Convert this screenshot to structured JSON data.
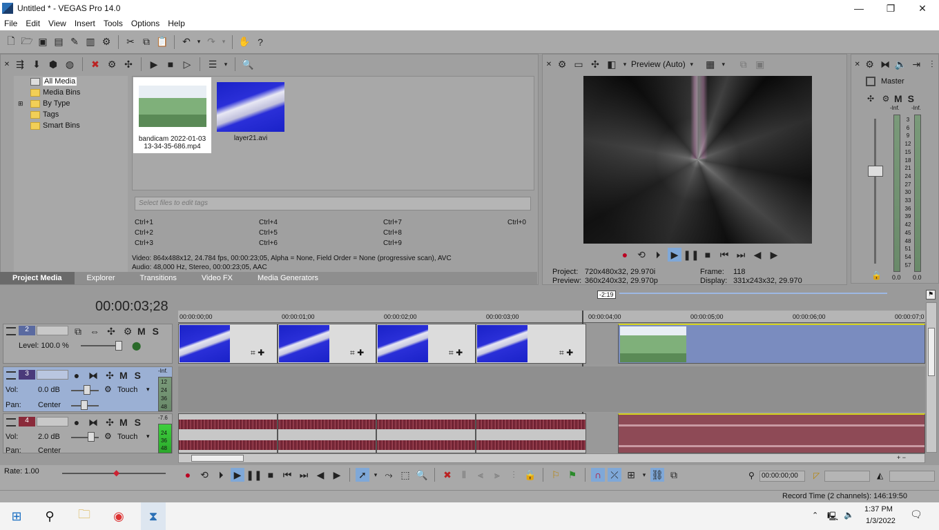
{
  "window": {
    "title": "Untitled * - VEGAS Pro 14.0",
    "controls": [
      "—",
      "❐",
      "✕"
    ]
  },
  "menu": [
    "File",
    "Edit",
    "View",
    "Insert",
    "Tools",
    "Options",
    "Help"
  ],
  "media_tree": [
    "All Media",
    "Media Bins",
    "By Type",
    "Tags",
    "Smart Bins"
  ],
  "media_items": [
    {
      "name": "bandicam 2022-01-03\n13-34-35-686.mp4"
    },
    {
      "name": "layer21.avi"
    }
  ],
  "tags": {
    "placeholder": "Select files to edit tags",
    "shortcuts": [
      "Ctrl+1",
      "Ctrl+4",
      "Ctrl+7",
      "Ctrl+0",
      "Ctrl+2",
      "Ctrl+5",
      "Ctrl+8",
      "Ctrl+3",
      "Ctrl+6",
      "Ctrl+9"
    ]
  },
  "media_info": {
    "video": "Video: 864x488x12, 24.784 fps, 00:00:23;05, Alpha = None, Field Order = None (progressive scan), AVC",
    "audio": "Audio: 48,000 Hz, Stereo, 00:00:23;05, AAC"
  },
  "tabs": [
    "Project Media",
    "Explorer",
    "Transitions",
    "Video FX",
    "Media Generators"
  ],
  "preview": {
    "mode": "Preview (Auto)",
    "project_label": "Project:",
    "project_value": "720x480x32, 29.970i",
    "preview_label": "Preview:",
    "preview_value": "360x240x32, 29.970p",
    "frame_label": "Frame:",
    "frame_value": "118",
    "display_label": "Display:",
    "display_value": "331x243x32, 29.970"
  },
  "mixer": {
    "label": "Master",
    "m": "M",
    "s": "S",
    "inf_left": "-Inf.",
    "inf_right": "-Inf.",
    "scale": [
      "3",
      "6",
      "9",
      "12",
      "15",
      "18",
      "21",
      "24",
      "27",
      "30",
      "33",
      "36",
      "39",
      "42",
      "45",
      "48",
      "51",
      "54",
      "57"
    ],
    "bottom_left": "0.0",
    "bottom_right": "0.0"
  },
  "timeline": {
    "timecode": "00:00:03;28",
    "marker": "-2:19",
    "ruler": [
      "00:00:00;00",
      "00:00:01;00",
      "00:00:02;00",
      "00:00:03;00",
      "00:00:04;00",
      "00:00:05;00",
      "00:00:06;00",
      "00:00:07;0"
    ]
  },
  "tracks": [
    {
      "num": "2",
      "level_label": "Level: 100.0 %",
      "m": "M",
      "s": "S"
    },
    {
      "num": "3",
      "vol_label": "Vol:",
      "vol_value": "0.0 dB",
      "pan_label": "Pan:",
      "pan_value": "Center",
      "touch": "Touch",
      "m": "M",
      "s": "S",
      "meter_top": "-Inf.",
      "meter_scale": [
        "12",
        "24",
        "36",
        "48"
      ]
    },
    {
      "num": "4",
      "vol_label": "Vol:",
      "vol_value": "2.0 dB",
      "pan_label": "Pan:",
      "pan_value": "Center",
      "touch": "Touch",
      "m": "M",
      "s": "S",
      "meter_top": "-7.6",
      "meter_scale": [
        "24",
        "36",
        "48"
      ]
    }
  ],
  "transport": {
    "rate": "Rate: 1.00",
    "time": "00:00:00;00"
  },
  "status": {
    "record_time": "Record Time (2 channels): 146:19:50"
  },
  "taskbar": {
    "time": "1:37 PM",
    "date": "1/3/2022"
  }
}
